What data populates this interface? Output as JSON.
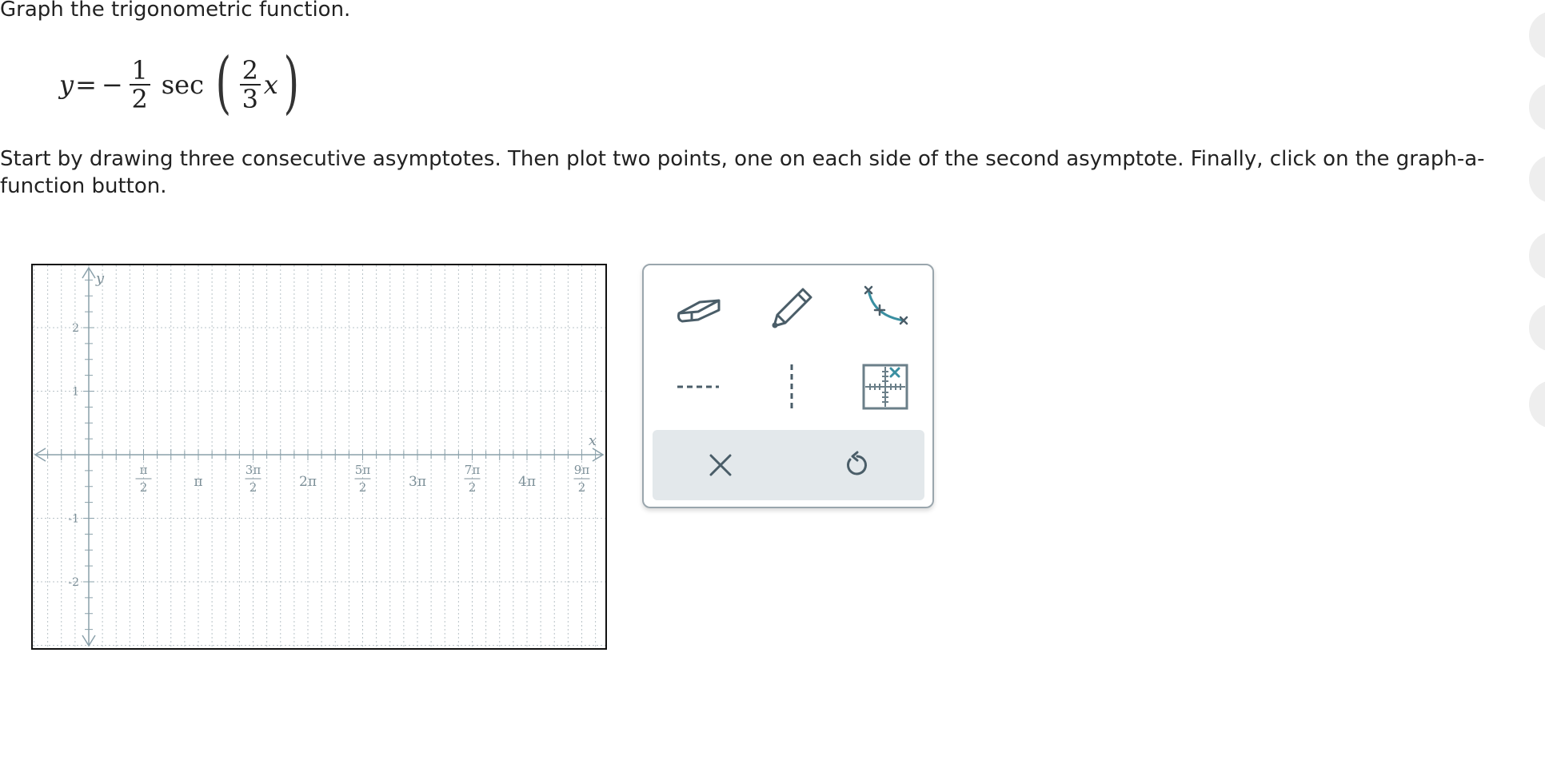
{
  "prompt": "Graph the trigonometric function.",
  "formula": {
    "y": "y",
    "equals": "=",
    "minus": "−",
    "coef_num": "1",
    "coef_den": "2",
    "func": "sec",
    "left_paren": "(",
    "arg_num": "2",
    "arg_den": "3",
    "x": "x",
    "right_paren": ")"
  },
  "instructions": "Start by drawing three consecutive asymptotes. Then plot two points, one on each side of the second asymptote. Finally, click on the graph-a-function button.",
  "graph": {
    "x_axis_label": "x",
    "y_axis_label": "y",
    "x_range": [
      -1,
      10
    ],
    "y_range": [
      -3,
      3
    ],
    "x_ticks": [
      {
        "value": 1,
        "num": "π",
        "den": "2"
      },
      {
        "value": 2,
        "text": "π"
      },
      {
        "value": 3,
        "num": "3π",
        "den": "2"
      },
      {
        "value": 4,
        "text": "2π"
      },
      {
        "value": 5,
        "num": "5π",
        "den": "2"
      },
      {
        "value": 6,
        "text": "3π"
      },
      {
        "value": 7,
        "num": "7π",
        "den": "2"
      },
      {
        "value": 8,
        "text": "4π"
      },
      {
        "value": 9,
        "num": "9π",
        "den": "2"
      }
    ],
    "y_ticks": [
      {
        "value": 2,
        "text": "2"
      },
      {
        "value": 1,
        "text": "1"
      },
      {
        "value": -1,
        "text": "-1"
      },
      {
        "value": -2,
        "text": "-2"
      }
    ],
    "grid": true
  },
  "toolbox": {
    "tools": [
      {
        "name": "eraser-tool",
        "icon": "eraser-icon"
      },
      {
        "name": "pencil-tool",
        "icon": "pencil-icon"
      },
      {
        "name": "graph-function-tool",
        "icon": "curve-points-icon"
      },
      {
        "name": "horizontal-asymptote-tool",
        "icon": "dashed-horizontal-line-icon"
      },
      {
        "name": "vertical-asymptote-tool",
        "icon": "dashed-vertical-line-icon"
      },
      {
        "name": "point-tool",
        "icon": "grid-point-icon"
      }
    ],
    "actions": [
      {
        "name": "clear-button",
        "icon": "close-icon"
      },
      {
        "name": "undo-button",
        "icon": "undo-icon"
      }
    ]
  },
  "colors": {
    "icon": "#4a5d68",
    "accent": "#3a8fa1",
    "axis": "#8aa0aa",
    "action_bar": "#e3e8eb"
  }
}
